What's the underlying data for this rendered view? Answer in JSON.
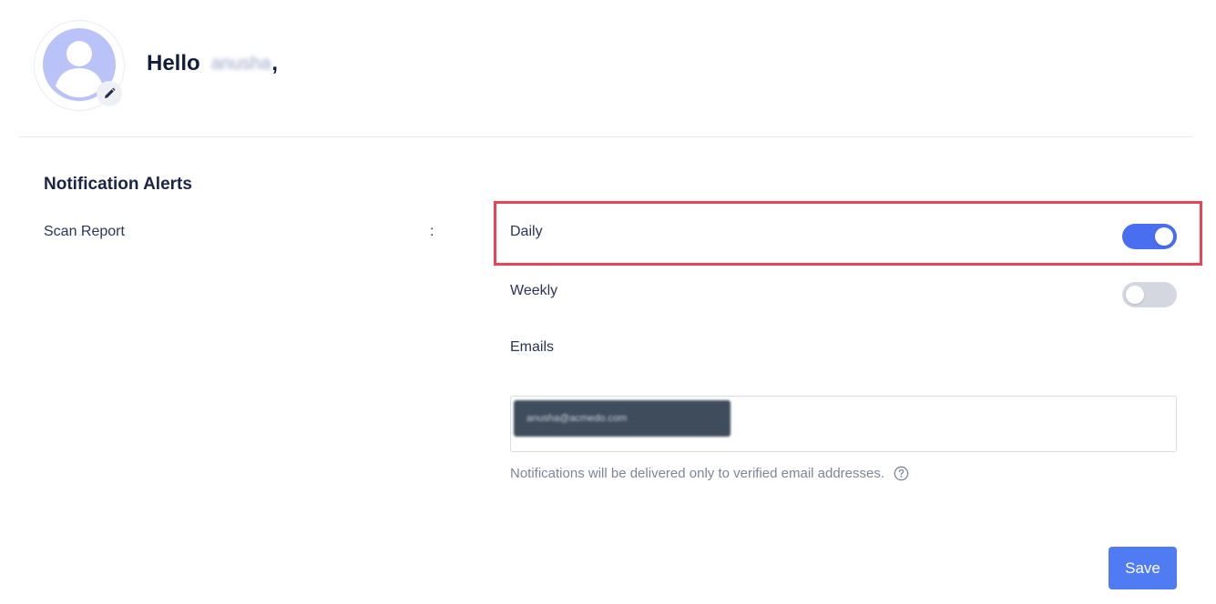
{
  "header": {
    "greeting": "Hello",
    "user_name": "anusha",
    "punctuation": ","
  },
  "notifications": {
    "section_title": "Notification Alerts",
    "scan_report_label": "Scan Report",
    "colon": ":",
    "options": {
      "daily": {
        "label": "Daily",
        "enabled": true
      },
      "weekly": {
        "label": "Weekly",
        "enabled": false
      }
    },
    "emails_label": "Emails",
    "email_chip": "anusha@acmedo.com",
    "hint": "Notifications will be delivered only to verified email addresses."
  },
  "actions": {
    "save_label": "Save"
  },
  "icons": {
    "avatar": "user-avatar-icon",
    "edit": "pencil-icon",
    "help": "question-circle-icon"
  },
  "colors": {
    "toggle_on": "#4a6ef0",
    "toggle_off": "#d4d7df",
    "highlight": "#e84457",
    "save_button": "#4f7bf3"
  }
}
